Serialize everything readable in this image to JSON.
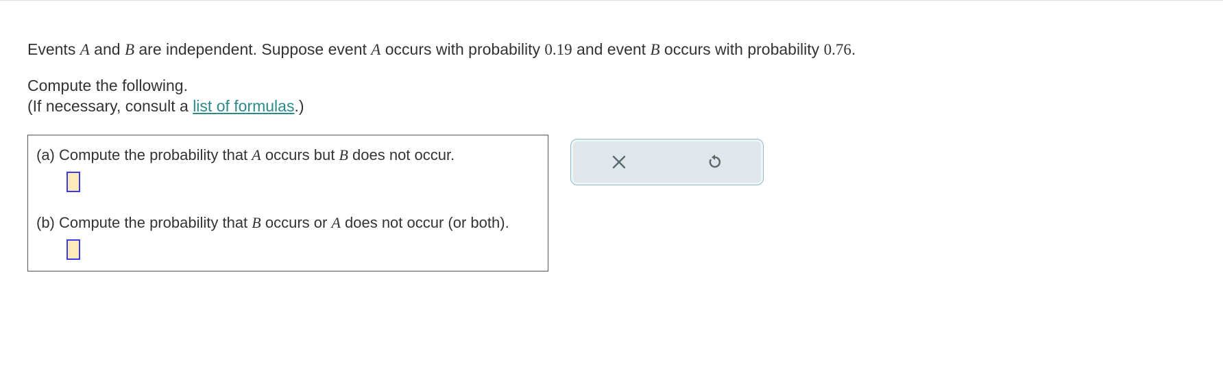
{
  "intro": {
    "t1": "Events ",
    "A": "A",
    "t2": " and ",
    "B": "B",
    "t3": " are independent. Suppose event ",
    "t4": " occurs with probability ",
    "pA": "0.19",
    "t5": " and event ",
    "t6": " occurs with probability ",
    "pB": "0.76",
    "t7": "."
  },
  "instructions": {
    "line1": "Compute the following.",
    "line2a": "(If necessary, consult a ",
    "link": "list of formulas",
    "line2b": ".)"
  },
  "parts": {
    "a": {
      "label": "(a) ",
      "t1": "Compute the probability that ",
      "t2": " occurs but ",
      "t3": " does not occur."
    },
    "b": {
      "label": "(b) ",
      "t1": "Compute the probability that ",
      "t2": " occurs or ",
      "t3": " does not occur (or both)."
    }
  },
  "vars": {
    "A": "A",
    "B": "B"
  },
  "toolbar": {
    "clear": "clear",
    "reset": "reset"
  }
}
